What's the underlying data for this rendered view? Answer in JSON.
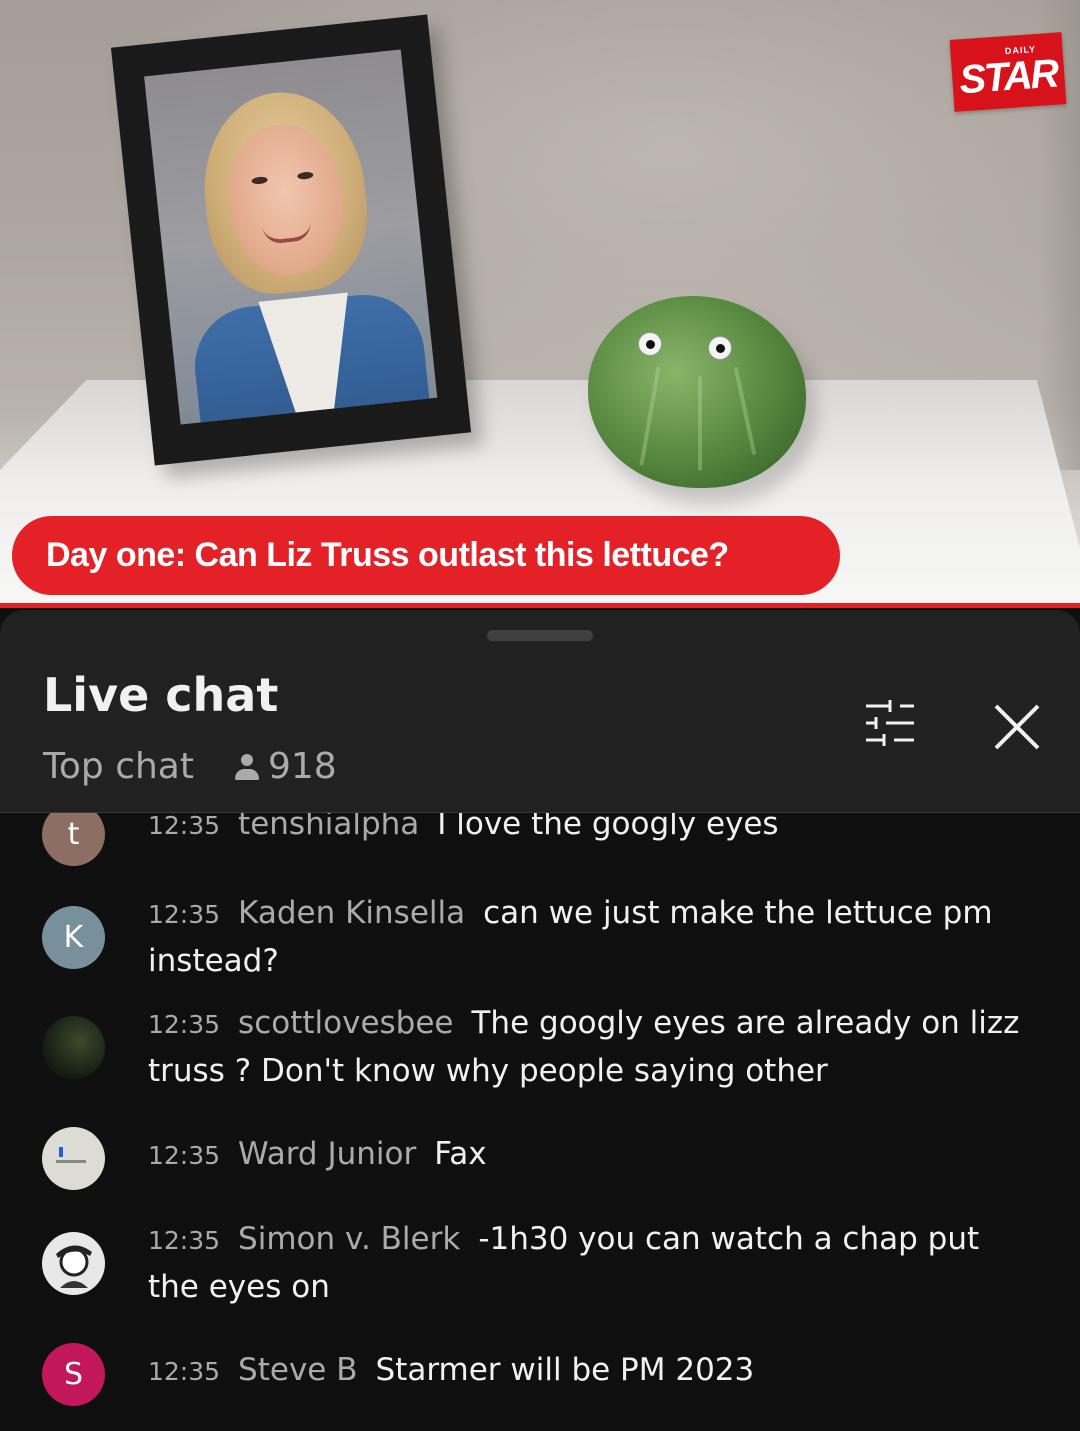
{
  "video": {
    "logo_small": "DAILY",
    "logo_main": "STAR",
    "headline": "Day one: Can Liz Truss outlast this lettuce?",
    "accent_color": "#e42127"
  },
  "chat": {
    "title": "Live chat",
    "mode": "Top chat",
    "viewer_count": "918",
    "icons": {
      "filter": "tune-sliders-icon",
      "close": "close-icon",
      "viewers": "person-icon"
    },
    "messages": [
      {
        "avatar_letter": "t",
        "avatar_color": "#8d6e63",
        "time": "12:35",
        "author": "tenshialpha",
        "text": "I love the googly eyes"
      },
      {
        "avatar_letter": "K",
        "avatar_color": "#78909c",
        "time": "12:35",
        "author": "Kaden Kinsella",
        "text": "can we just make the lettuce pm instead?"
      },
      {
        "avatar_letter": "",
        "avatar_color": "#1c2418",
        "time": "12:35",
        "author": "scottlovesbee",
        "text": "The googly eyes are already on lizz truss ? Don't know why people saying other"
      },
      {
        "avatar_letter": "",
        "avatar_color": "#dcdcd4",
        "time": "12:35",
        "author": "Ward Junior",
        "text": "Fax"
      },
      {
        "avatar_letter": "",
        "avatar_color": "#e8e8e8",
        "time": "12:35",
        "author": "Simon v. Blerk",
        "text": "-1h30 you can watch a chap put the eyes on"
      },
      {
        "avatar_letter": "S",
        "avatar_color": "#c2185b",
        "time": "12:35",
        "author": "Steve B",
        "text": "Starmer will be PM 2023"
      }
    ]
  }
}
